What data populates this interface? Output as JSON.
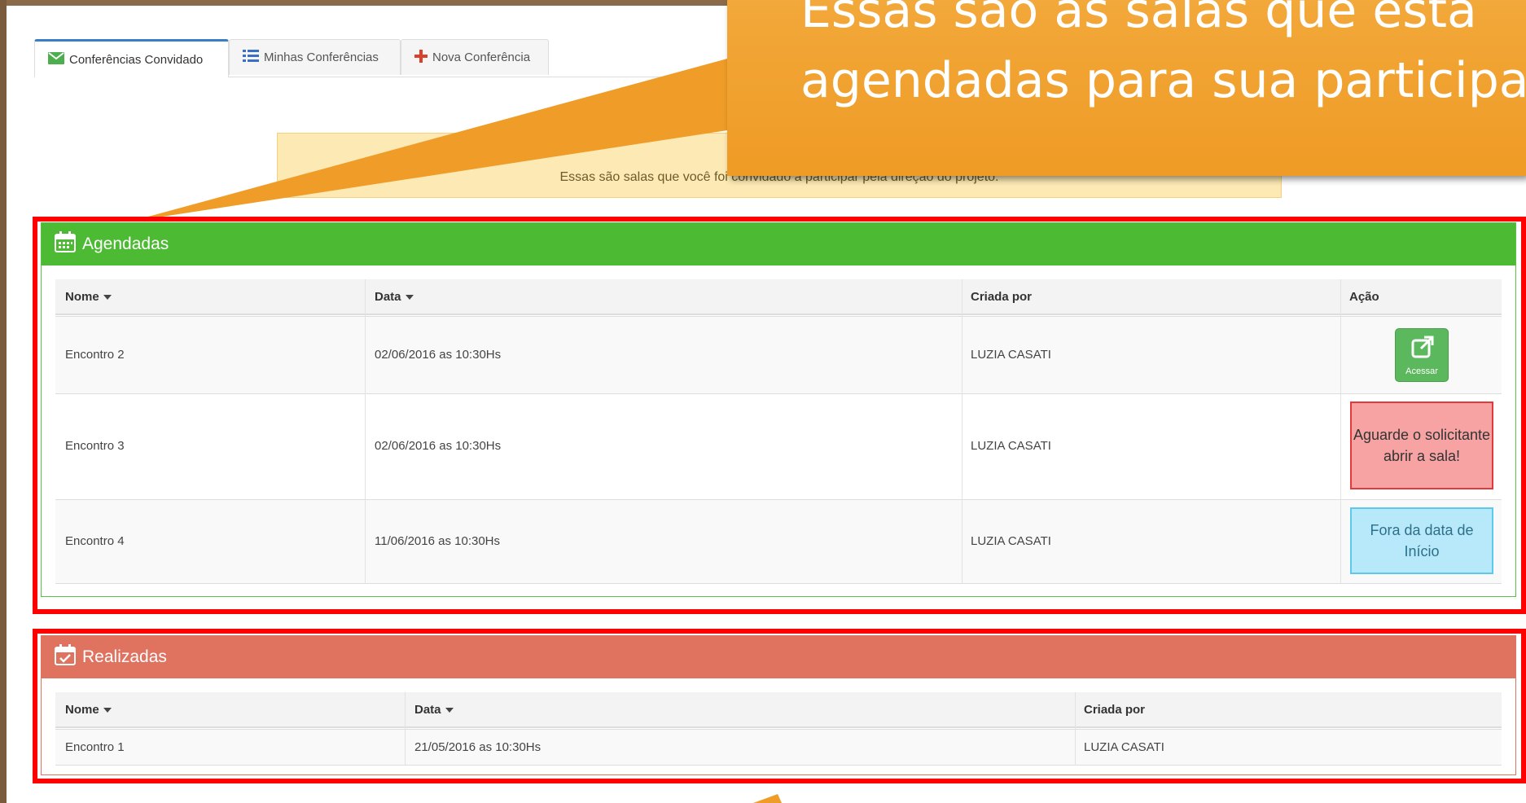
{
  "tabs": [
    {
      "label": "Conferências Convidado"
    },
    {
      "label": "Minhas Conferências"
    },
    {
      "label": "Nova Conferência"
    }
  ],
  "alert": {
    "text": "Essas são salas que você foi convidado a participar pela direção do projeto."
  },
  "callout": {
    "line1": "Essas são as salas que estã",
    "line2": "agendadas para sua participa"
  },
  "agendadas": {
    "title": "Agendadas",
    "headers": {
      "nome": "Nome",
      "data": "Data",
      "criada": "Criada por",
      "acao": "Ação"
    },
    "rows": [
      {
        "nome": "Encontro 2",
        "data": "02/06/2016 as 10:30Hs",
        "criada": "LUZIA CASATI"
      },
      {
        "nome": "Encontro 3",
        "data": "02/06/2016 as 10:30Hs",
        "criada": "LUZIA CASATI"
      },
      {
        "nome": "Encontro 4",
        "data": "11/06/2016 as 10:30Hs",
        "criada": "LUZIA CASATI"
      }
    ],
    "acessar_label": "Acessar",
    "aguarde_text": "Aguarde o solicitante abrir a sala!",
    "fora_text": "Fora da data de Início"
  },
  "realizadas": {
    "title": "Realizadas",
    "headers": {
      "nome": "Nome",
      "data": "Data",
      "criada": "Criada por"
    },
    "rows": [
      {
        "nome": "Encontro 1",
        "data": "21/05/2016 as 10:30Hs",
        "criada": "LUZIA CASATI"
      }
    ]
  },
  "colors": {
    "green": "#4cbb33",
    "red": "#e07260",
    "highlight": "#ff0000",
    "callout": "#f2a33a"
  }
}
